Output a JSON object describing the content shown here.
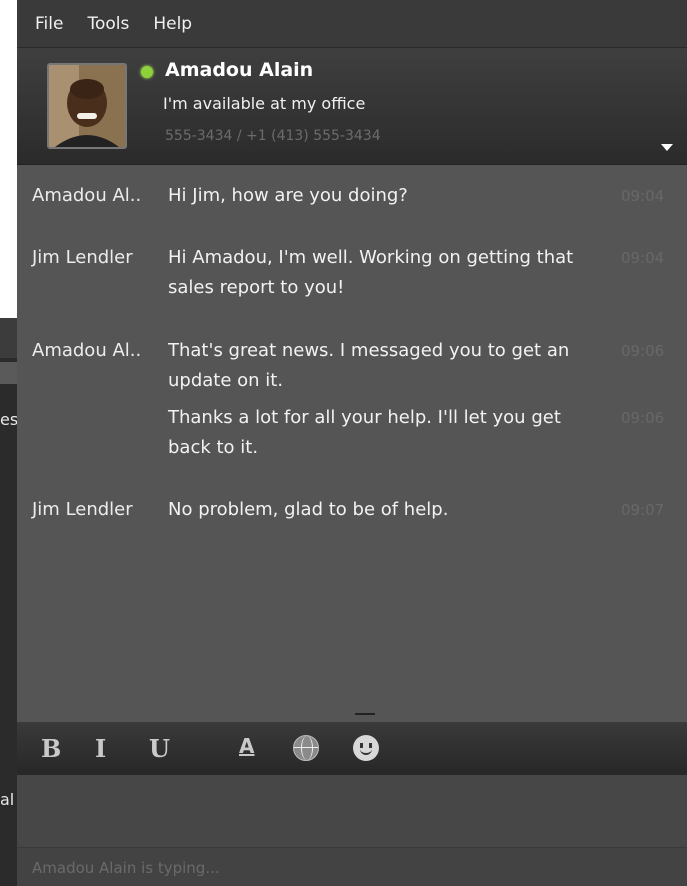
{
  "menu": {
    "file": "File",
    "tools": "Tools",
    "help": "Help"
  },
  "contact": {
    "name": "Amadou Alain",
    "status_message": "I'm available at my office",
    "phone": "555-3434 / +1 (413) 555-3434",
    "presence": "available",
    "presence_color": "#8fd13a"
  },
  "messages": [
    {
      "sender": "Amadou Al..",
      "text": "Hi Jim, how are you doing?",
      "time": "09:04"
    },
    {
      "sender": "Jim Lendler",
      "text": "Hi Amadou, I'm well.  Working on getting that sales report to you!",
      "time": "09:04"
    },
    {
      "sender": "Amadou Al..",
      "text": "That's great news. I messaged you to get an update on it.",
      "time": "09:06"
    },
    {
      "sender": "",
      "text": "Thanks a lot for all your help. I'll let you get back to it.",
      "time": "09:06"
    },
    {
      "sender": "Jim Lendler",
      "text": "No problem, glad to be of help.",
      "time": "09:07"
    }
  ],
  "toolbar": {
    "bold": "B",
    "italic": "I",
    "underline": "U",
    "font_color": "A",
    "globe_icon": "globe-icon",
    "emoticon_icon": "smiley-icon"
  },
  "typing_indicator": "Amadou Alain is typing...",
  "background_window": {
    "partial_text_1": "es",
    "partial_text_2": "al"
  }
}
